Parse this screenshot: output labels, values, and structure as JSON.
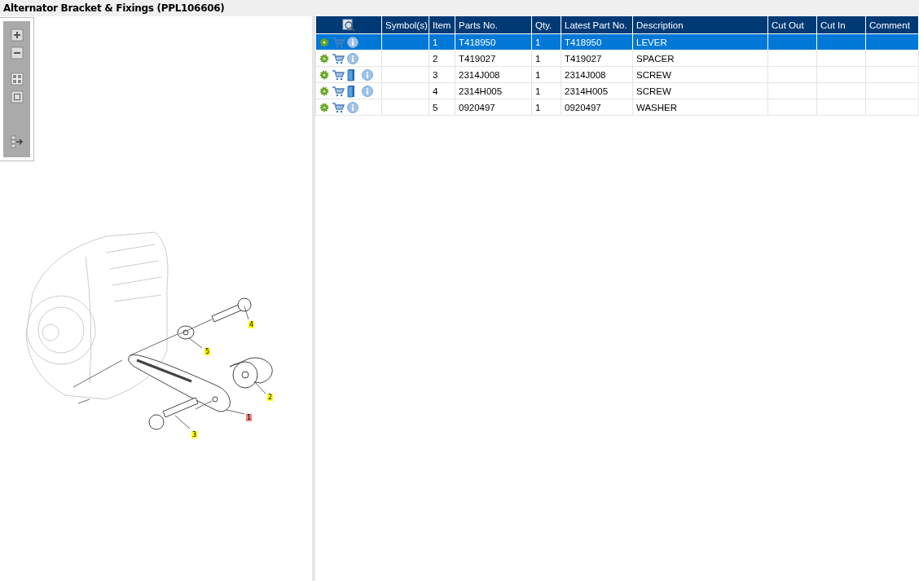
{
  "window": {
    "title": "Alternator Bracket & Fixings (PPL106606)"
  },
  "drawing": {
    "callouts": [
      {
        "label": "4",
        "color": "#ffff00"
      },
      {
        "label": "5",
        "color": "#ffff00"
      },
      {
        "label": "2",
        "color": "#ffff00"
      },
      {
        "label": "1",
        "color": "#f08080"
      },
      {
        "label": "3",
        "color": "#ffff00"
      }
    ]
  },
  "table": {
    "columns": [
      "Symbol(s)",
      "Item",
      "Parts No.",
      "Qty.",
      "Latest Part No.",
      "Description",
      "Cut Out",
      "Cut In",
      "Comment"
    ],
    "rows": [
      {
        "selected": true,
        "has_document": false,
        "item": "1",
        "part_no": "T418950",
        "qty": "1",
        "latest_part_no": "T418950",
        "description": "LEVER"
      },
      {
        "selected": false,
        "has_document": false,
        "item": "2",
        "part_no": "T419027",
        "qty": "1",
        "latest_part_no": "T419027",
        "description": "SPACER"
      },
      {
        "selected": false,
        "has_document": true,
        "item": "3",
        "part_no": "2314J008",
        "qty": "1",
        "latest_part_no": "2314J008",
        "description": "SCREW"
      },
      {
        "selected": false,
        "has_document": true,
        "item": "4",
        "part_no": "2314H005",
        "qty": "1",
        "latest_part_no": "2314H005",
        "description": "SCREW"
      },
      {
        "selected": false,
        "has_document": false,
        "item": "5",
        "part_no": "0920497",
        "qty": "1",
        "latest_part_no": "0920497",
        "description": "WASHER"
      }
    ]
  }
}
